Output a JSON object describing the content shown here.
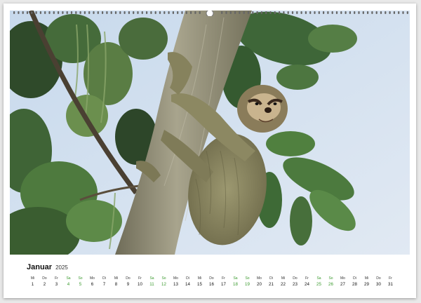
{
  "calendar": {
    "month": "Januar",
    "year": "2025",
    "days": [
      {
        "dow": "Mi",
        "num": "1",
        "weekend": false
      },
      {
        "dow": "Do",
        "num": "2",
        "weekend": false
      },
      {
        "dow": "Fr",
        "num": "3",
        "weekend": false
      },
      {
        "dow": "Sa",
        "num": "4",
        "weekend": true
      },
      {
        "dow": "So",
        "num": "5",
        "weekend": true
      },
      {
        "dow": "Mo",
        "num": "6",
        "weekend": false
      },
      {
        "dow": "Di",
        "num": "7",
        "weekend": false
      },
      {
        "dow": "Mi",
        "num": "8",
        "weekend": false
      },
      {
        "dow": "Do",
        "num": "9",
        "weekend": false
      },
      {
        "dow": "Fr",
        "num": "10",
        "weekend": false
      },
      {
        "dow": "Sa",
        "num": "11",
        "weekend": true
      },
      {
        "dow": "So",
        "num": "12",
        "weekend": true
      },
      {
        "dow": "Mo",
        "num": "13",
        "weekend": false
      },
      {
        "dow": "Di",
        "num": "14",
        "weekend": false
      },
      {
        "dow": "Mi",
        "num": "15",
        "weekend": false
      },
      {
        "dow": "Do",
        "num": "16",
        "weekend": false
      },
      {
        "dow": "Fr",
        "num": "17",
        "weekend": false
      },
      {
        "dow": "Sa",
        "num": "18",
        "weekend": true
      },
      {
        "dow": "So",
        "num": "19",
        "weekend": true
      },
      {
        "dow": "Mo",
        "num": "20",
        "weekend": false
      },
      {
        "dow": "Di",
        "num": "21",
        "weekend": false
      },
      {
        "dow": "Mi",
        "num": "22",
        "weekend": false
      },
      {
        "dow": "Do",
        "num": "23",
        "weekend": false
      },
      {
        "dow": "Fr",
        "num": "24",
        "weekend": false
      },
      {
        "dow": "Sa",
        "num": "25",
        "weekend": true
      },
      {
        "dow": "So",
        "num": "26",
        "weekend": true
      },
      {
        "dow": "Mo",
        "num": "27",
        "weekend": false
      },
      {
        "dow": "Di",
        "num": "28",
        "weekend": false
      },
      {
        "dow": "Mi",
        "num": "29",
        "weekend": false
      },
      {
        "dow": "Do",
        "num": "30",
        "weekend": false
      },
      {
        "dow": "Fr",
        "num": "31",
        "weekend": false
      }
    ]
  },
  "colors": {
    "weekend": "#3a9a2e",
    "weekday": "#111111",
    "sky": "#cfdff0",
    "trunk": "#8a8672",
    "sloth_fur": "#8e8a63"
  },
  "icons": {
    "binding": "spiral-binding-icon",
    "photo": "sloth-on-tree-photo"
  }
}
